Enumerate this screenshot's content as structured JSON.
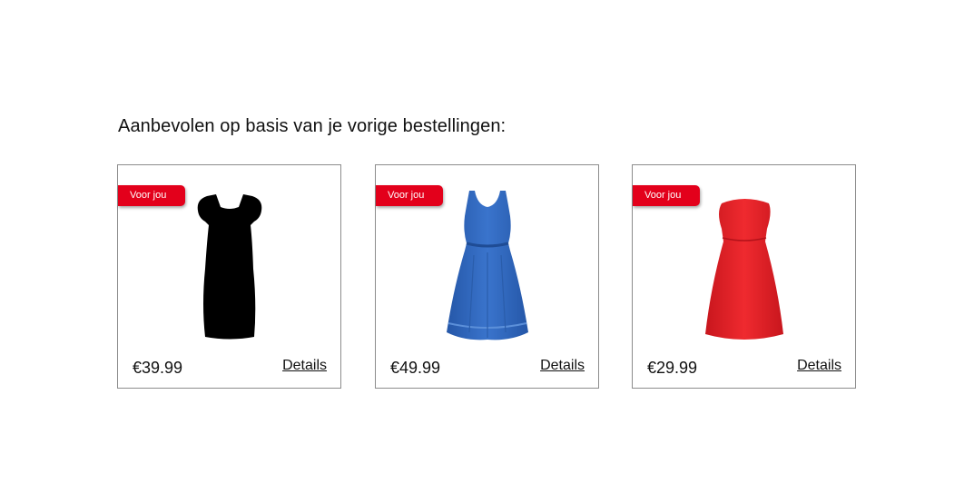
{
  "heading": "Aanbevolen op basis van je vorige bestellingen:",
  "accent_color": "#e3001b",
  "products": [
    {
      "badge": "Voor jou",
      "price": "€39.99",
      "details_label": "Details",
      "image": "black-dress-silhouette",
      "color": "#000000"
    },
    {
      "badge": "Voor jou",
      "price": "€49.99",
      "details_label": "Details",
      "image": "blue-sleeveless-dress",
      "color": "#2f64b8"
    },
    {
      "badge": "Voor jou",
      "price": "€29.99",
      "details_label": "Details",
      "image": "red-strapless-dress",
      "color": "#e41f26"
    }
  ]
}
